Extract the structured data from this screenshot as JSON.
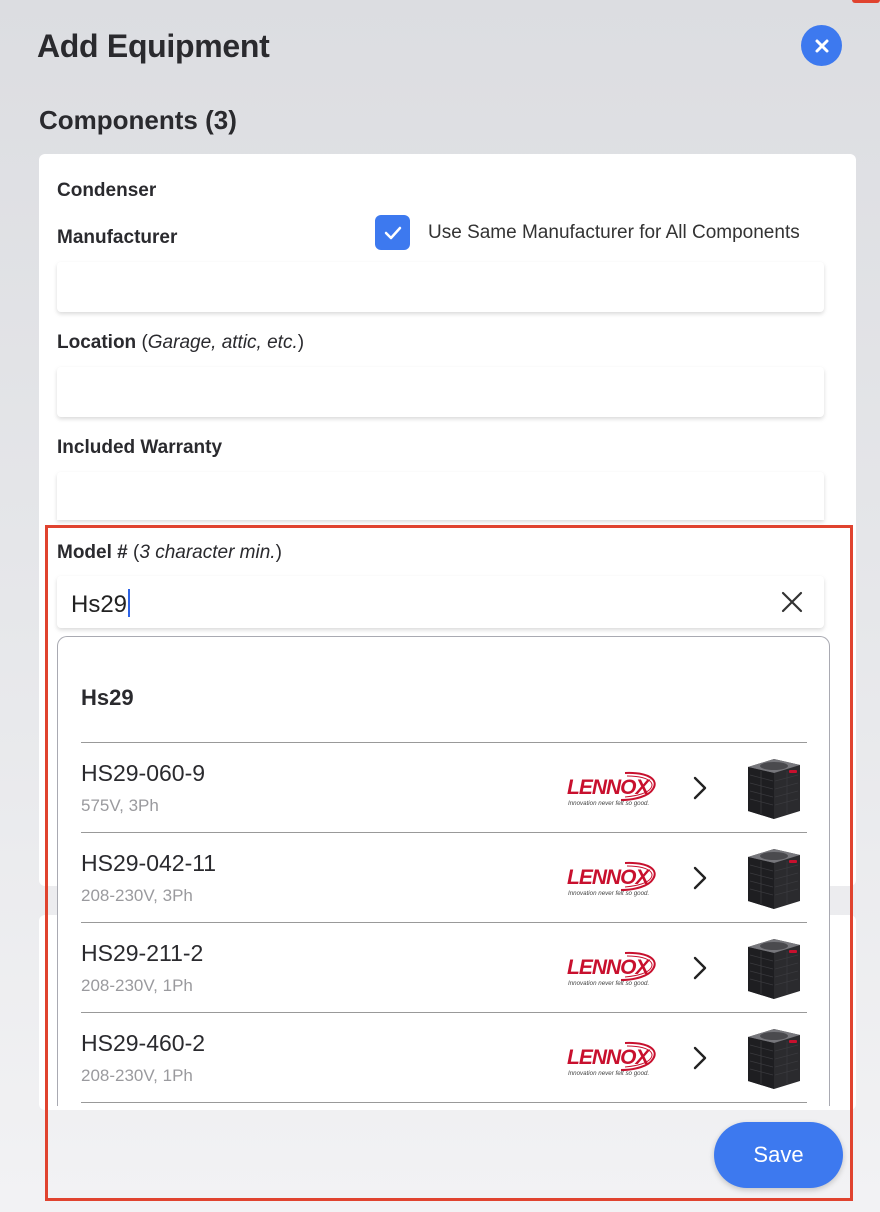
{
  "header": {
    "title": "Add Equipment",
    "close_icon": "close-icon"
  },
  "section": {
    "title": "Components (3)"
  },
  "component": {
    "name": "Condenser",
    "manufacturer_label": "Manufacturer",
    "same_manufacturer_checked": true,
    "same_manufacturer_label": "Use Same Manufacturer for All Components",
    "manufacturer_value": "",
    "location_label": "Location",
    "location_hint": "Garage, attic, etc.",
    "location_value": "",
    "warranty_label": "Included Warranty",
    "warranty_value": "",
    "model_label": "Model #",
    "model_hint": "3 character min.",
    "model_value": "Hs29"
  },
  "dropdown": {
    "query": "Hs29",
    "results": [
      {
        "model": "HS29-060-9",
        "spec": "575V, 3Ph"
      },
      {
        "model": "HS29-042-11",
        "spec": "208-230V, 3Ph"
      },
      {
        "model": "HS29-211-2",
        "spec": "208-230V, 1Ph"
      },
      {
        "model": "HS29-460-2",
        "spec": "208-230V, 1Ph"
      }
    ],
    "brand": {
      "name": "LENNOX",
      "tagline": "Innovation never felt so good."
    }
  },
  "footer": {
    "save_label": "Save"
  },
  "colors": {
    "accent": "#3d79ef",
    "highlight": "#e0432f",
    "brand_red": "#c8102e"
  }
}
